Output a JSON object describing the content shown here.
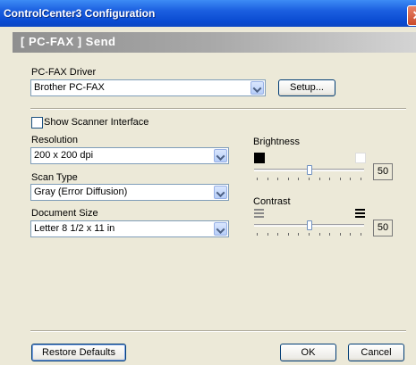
{
  "window": {
    "title": "ControlCenter3 Configuration",
    "close": "✕"
  },
  "header": {
    "text": "[ PC-FAX ]  Send"
  },
  "driver": {
    "label": "PC-FAX Driver",
    "value": "Brother PC-FAX",
    "setup_button": "Setup..."
  },
  "scanner": {
    "show_interface_label": "Show Scanner Interface",
    "checked": false
  },
  "resolution": {
    "label": "Resolution",
    "value": "200 x 200 dpi"
  },
  "scan_type": {
    "label": "Scan Type",
    "value": "Gray (Error Diffusion)"
  },
  "document_size": {
    "label": "Document Size",
    "value": "Letter 8 1/2 x 11 in"
  },
  "brightness": {
    "label": "Brightness",
    "value": "50",
    "level": 0.5
  },
  "contrast": {
    "label": "Contrast",
    "value": "50",
    "level": 0.5
  },
  "footer": {
    "restore": "Restore Defaults",
    "ok": "OK",
    "cancel": "Cancel"
  }
}
